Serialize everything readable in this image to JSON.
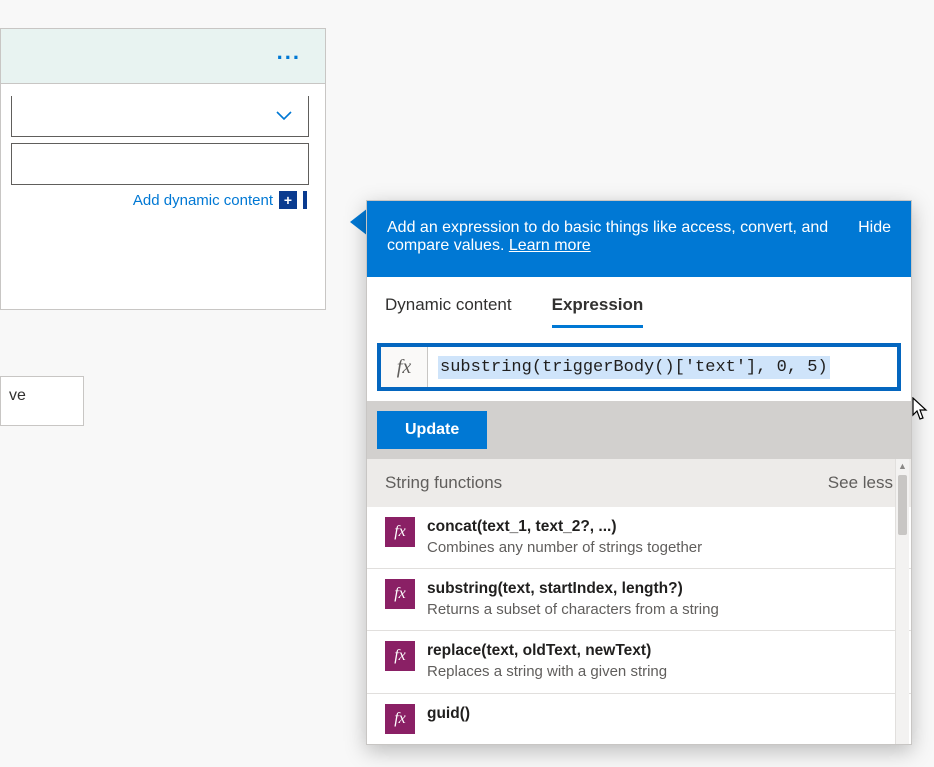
{
  "left_card": {
    "ellipsis_icon": "ellipsis",
    "add_dynamic_content": "Add dynamic content"
  },
  "fragment": {
    "text": "ve"
  },
  "panel": {
    "header_text": "Add an expression to do basic things like access, convert, and compare values.",
    "learn_more": "Learn more",
    "hide": "Hide",
    "tabs": {
      "dynamic": "Dynamic content",
      "expression": "Expression"
    },
    "fx_label": "fx",
    "expression_value": "substring(triggerBody()['text'], 0, 5)",
    "update": "Update",
    "group_title": "String functions",
    "see_less": "See less",
    "functions": [
      {
        "sig": "concat(text_1, text_2?, ...)",
        "desc": "Combines any number of strings together"
      },
      {
        "sig": "substring(text, startIndex, length?)",
        "desc": "Returns a subset of characters from a string"
      },
      {
        "sig": "replace(text, oldText, newText)",
        "desc": "Replaces a string with a given string"
      },
      {
        "sig": "guid()",
        "desc": ""
      }
    ]
  }
}
